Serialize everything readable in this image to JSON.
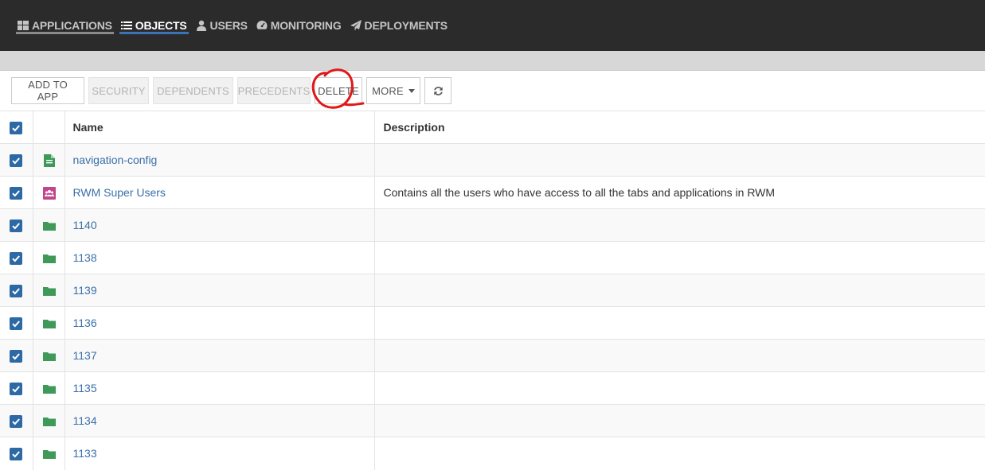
{
  "nav": {
    "items": [
      {
        "label": "APPLICATIONS",
        "icon": "grid-icon",
        "active": false
      },
      {
        "label": "OBJECTS",
        "icon": "list-icon",
        "active": true
      },
      {
        "label": "USERS",
        "icon": "user-icon",
        "active": false
      },
      {
        "label": "MONITORING",
        "icon": "dashboard-icon",
        "active": false
      },
      {
        "label": "DEPLOYMENTS",
        "icon": "paper-plane-icon",
        "active": false
      }
    ]
  },
  "toolbar": {
    "add_to_app": "ADD TO APP",
    "security": "SECURITY",
    "dependents": "DEPENDENTS",
    "precedents": "PRECEDENTS",
    "delete": "DELETE",
    "more": "MORE",
    "refresh_icon": "refresh-icon"
  },
  "table": {
    "headers": {
      "name": "Name",
      "description": "Description"
    },
    "rows": [
      {
        "name": "navigation-config",
        "description": "",
        "icon": "document-icon",
        "checked": true
      },
      {
        "name": "RWM Super Users",
        "description": "Contains all the users who have access to all the tabs and applications in RWM",
        "icon": "group-icon",
        "checked": true
      },
      {
        "name": "1140",
        "description": "",
        "icon": "folder-icon",
        "checked": true
      },
      {
        "name": "1138",
        "description": "",
        "icon": "folder-icon",
        "checked": true
      },
      {
        "name": "1139",
        "description": "",
        "icon": "folder-icon",
        "checked": true
      },
      {
        "name": "1136",
        "description": "",
        "icon": "folder-icon",
        "checked": true
      },
      {
        "name": "1137",
        "description": "",
        "icon": "folder-icon",
        "checked": true
      },
      {
        "name": "1135",
        "description": "",
        "icon": "folder-icon",
        "checked": true
      },
      {
        "name": "1134",
        "description": "",
        "icon": "folder-icon",
        "checked": true
      },
      {
        "name": "1133",
        "description": "",
        "icon": "folder-icon",
        "checked": true
      }
    ]
  },
  "colors": {
    "topbar": "#2b2b2b",
    "active_underline": "#3b73b9",
    "checkbox": "#2d6aa5",
    "link": "#3a6fa8",
    "folder": "#3f9a5a",
    "group": "#c0478a",
    "annotation": "#e01818"
  }
}
